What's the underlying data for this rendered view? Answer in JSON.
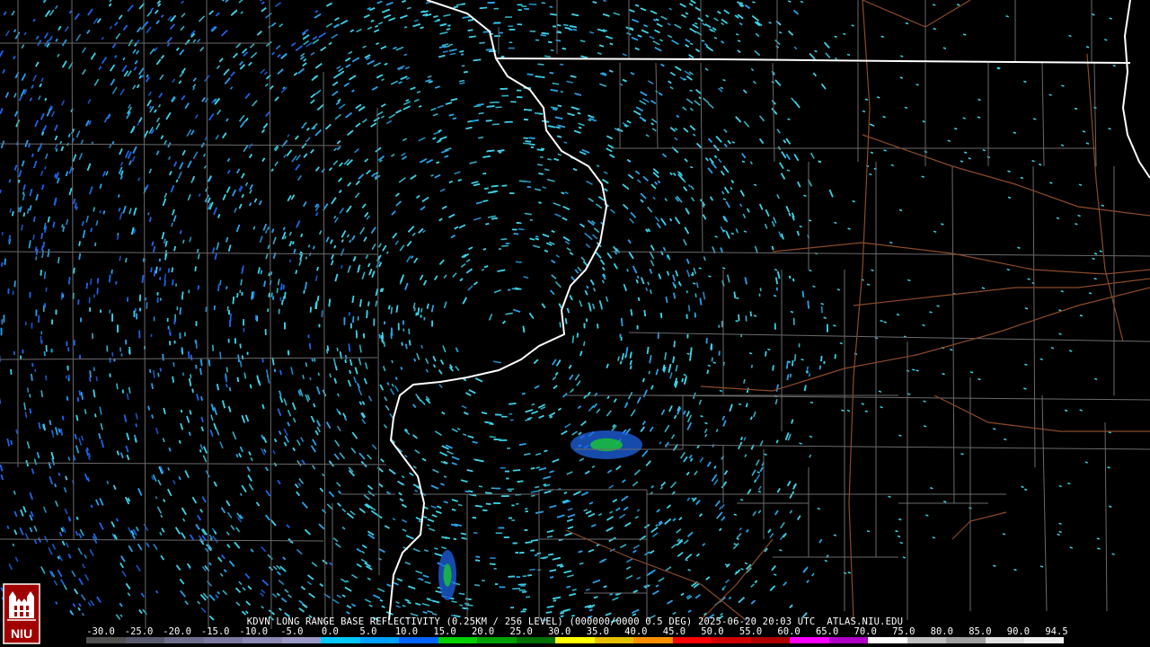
{
  "header": {
    "product_line": "KDVN LONG RANGE BASE REFLECTIVITY (0.25KM / 256 LEVEL) (000000/0000 0.5 DEG) 2025-06-20 20:03 UTC  ATLAS.NIU.EDU"
  },
  "scale": {
    "labels": [
      "-30.0",
      "-25.0",
      "-20.0",
      "-15.0",
      "-10.0",
      "-5.0",
      "0.0",
      "5.0",
      "10.0",
      "15.0",
      "20.0",
      "25.0",
      "30.0",
      "35.0",
      "40.0",
      "45.0",
      "50.0",
      "55.0",
      "60.0",
      "65.0",
      "70.0",
      "75.0",
      "80.0",
      "85.0",
      "90.0",
      "94.5"
    ],
    "colors": [
      "#505050",
      "#5a5a6e",
      "#6e6e8c",
      "#7a7aa0",
      "#8a8ab4",
      "#9a9ac8",
      "#00c8ff",
      "#00a0ff",
      "#0064ff",
      "#00d000",
      "#00a000",
      "#007000",
      "#ffff00",
      "#e6c000",
      "#ff9000",
      "#ff0000",
      "#d00000",
      "#b00000",
      "#ff00ff",
      "#b000c8",
      "#ffffff",
      "#c0c0c0",
      "#a0a0a0",
      "#e0e0e0",
      "#f0f0f0"
    ]
  },
  "logo": {
    "text": "NIU"
  },
  "colors": {
    "background": "#000000",
    "state_border": "#ffffff",
    "county_line": "#6e6e6e",
    "highway": "#8b4a2a",
    "echo_light": "#3cd2e6",
    "echo_deep": "#1e64e6",
    "echo_green": "#19c832"
  }
}
